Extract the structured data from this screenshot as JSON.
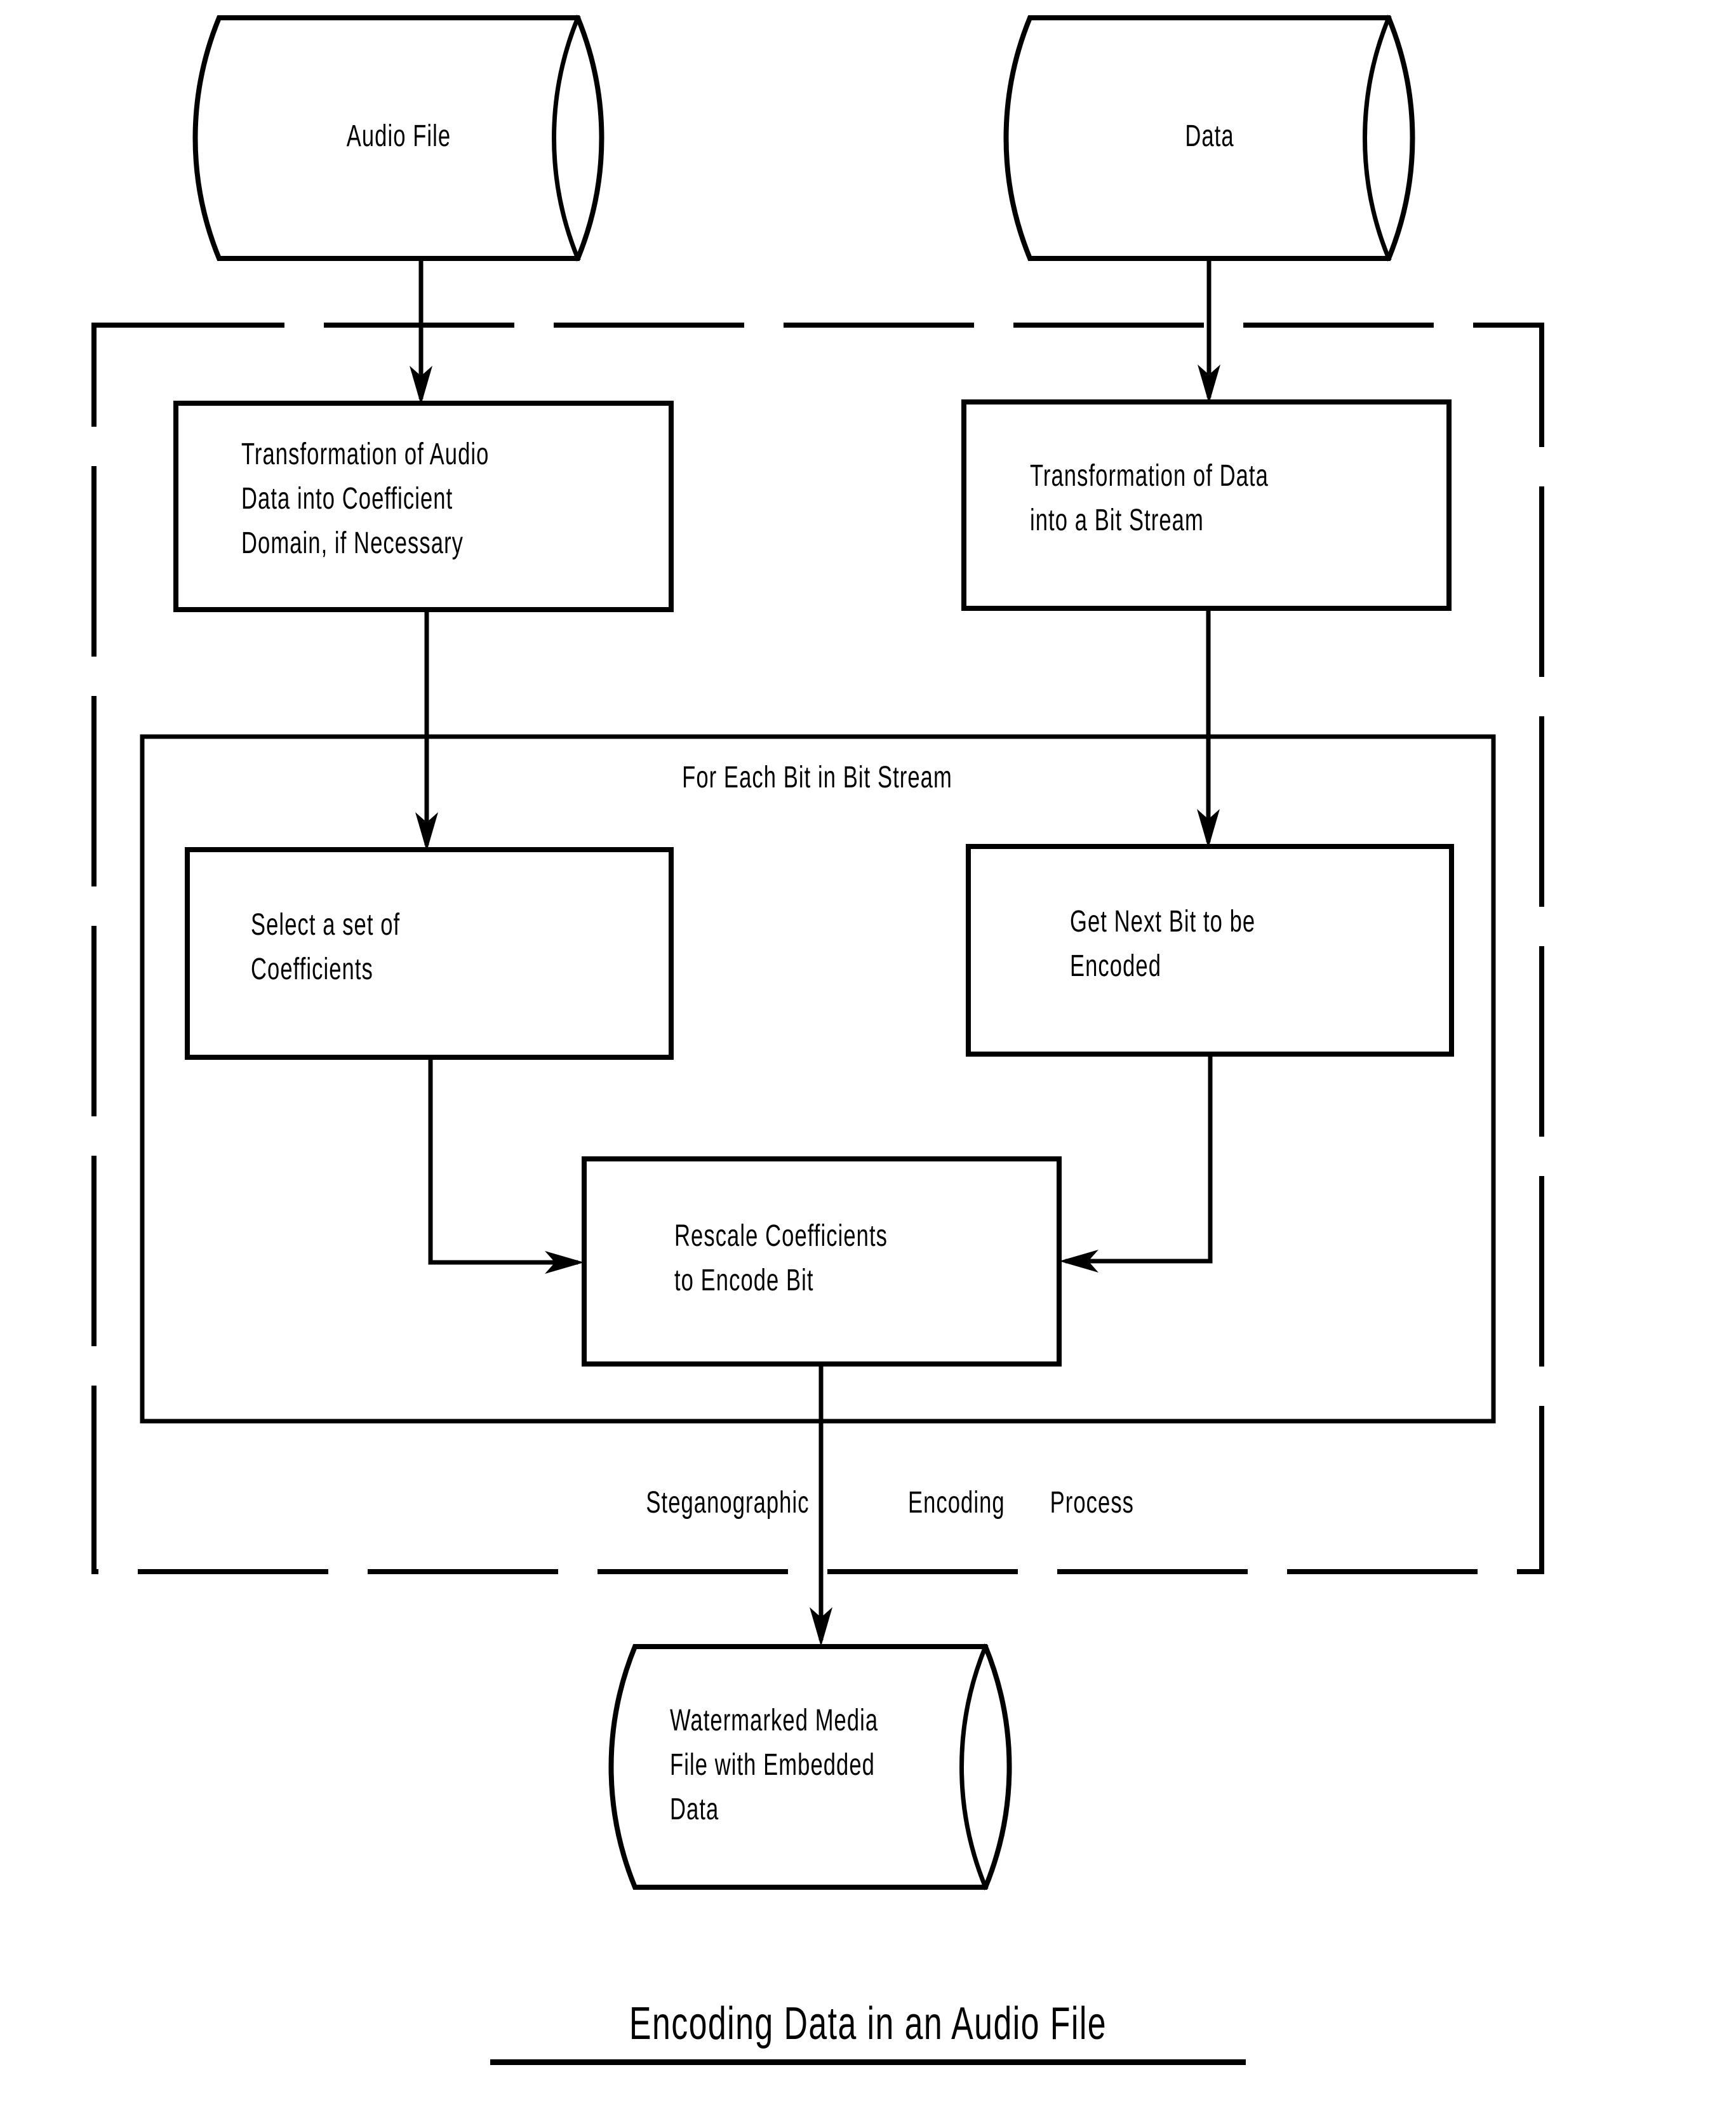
{
  "figure": {
    "title": "Encoding Data in an Audio File",
    "title_underlined": true,
    "ink_color": "#000000",
    "background_color": "#ffffff"
  },
  "sources": [
    {
      "id": "audio-file",
      "shape": "cylinder",
      "label": "Audio File"
    },
    {
      "id": "data",
      "shape": "cylinder",
      "label": "Data"
    }
  ],
  "process_region": {
    "label": "Steganographic   Encoding   Process",
    "border_style": "dashed"
  },
  "loop_region": {
    "label": "For Each Bit in Bit Stream",
    "border_style": "solid"
  },
  "steps": [
    {
      "id": "transform-audio",
      "lines": [
        "Transformation of Audio",
        "Data into Coefficient",
        "Domain, if Necessary"
      ]
    },
    {
      "id": "transform-data",
      "lines": [
        "Transformation of Data",
        "into a Bit Stream"
      ]
    },
    {
      "id": "select-coefficients",
      "lines": [
        "Select a set of",
        "Coefficients"
      ]
    },
    {
      "id": "get-next-bit",
      "lines": [
        "Get Next Bit to be",
        "Encoded"
      ]
    },
    {
      "id": "rescale-coefficients",
      "lines": [
        "Rescale Coefficients",
        "to Encode Bit"
      ]
    }
  ],
  "output": {
    "id": "watermarked-media-file",
    "shape": "cylinder",
    "lines": [
      "Watermarked Media",
      "File with Embedded",
      "Data"
    ]
  },
  "text": {
    "audio_file": "Audio File",
    "data": "Data",
    "transform_audio_l1": "Transformation of Audio",
    "transform_audio_l2": "Data into Coefficient",
    "transform_audio_l3": "Domain, if Necessary",
    "transform_data_l1": "Transformation of Data",
    "transform_data_l2": "into a Bit Stream",
    "loop_label": "For Each Bit in Bit Stream",
    "select_coeff_l1": "Select a set of",
    "select_coeff_l2": "Coefficients",
    "get_next_bit_l1": "Get Next Bit to be",
    "get_next_bit_l2": "Encoded",
    "rescale_l1": "Rescale Coefficients",
    "rescale_l2": "to Encode Bit",
    "region_label_a": "Steganographic",
    "region_label_b": "Encoding   Process",
    "output_l1": "Watermarked Media",
    "output_l2": "File with Embedded",
    "output_l3": "Data",
    "title": "Encoding Data in an Audio File"
  }
}
